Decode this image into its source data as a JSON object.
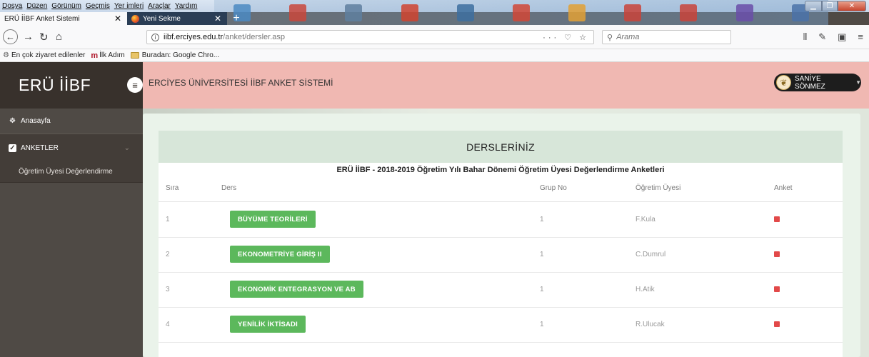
{
  "browser": {
    "menu": [
      "Dosya",
      "Düzen",
      "Görünüm",
      "Geçmiş",
      "Yer imleri",
      "Araçlar",
      "Yardım"
    ],
    "tabs": [
      {
        "label": "ERÜ İİBF Anket Sistemi"
      },
      {
        "label": "Yeni Sekme"
      }
    ],
    "url_host": "iibf.erciyes.edu.tr",
    "url_path": "/anket/dersler.asp",
    "search_placeholder": "Arama",
    "bookmarks": [
      "En çok ziyaret edilenler",
      "İlk Adım",
      "Buradan: Google Chro..."
    ]
  },
  "sidebar": {
    "brand": "ERÜ İİBF",
    "items": [
      {
        "label": "Anasayfa",
        "icon": "dashboard-icon"
      },
      {
        "label": "ANKETLER",
        "icon": "checkbox-icon"
      }
    ],
    "submenu": [
      "Öğretim Üyesi Değerlendirme"
    ]
  },
  "topbar": {
    "title": "ERCİYES ÜNİVERSİTESİ İİBF ANKET SİSTEMİ",
    "user": "SANİYE SÖNMEZ"
  },
  "courses_card": {
    "header": "DERSLERİNİZ",
    "subtitle": "ERÜ İİBF - 2018-2019 Öğretim Yılı Bahar Dönemi Öğretim Üyesi Değerlendirme Anketleri",
    "columns": [
      "Sıra",
      "Ders",
      "Grup No",
      "Öğretim Üyesi",
      "Anket"
    ],
    "rows": [
      {
        "no": "1",
        "course": "BÜYÜME TEORİLERİ",
        "group": "1",
        "teacher": "F.Kula"
      },
      {
        "no": "2",
        "course": "EKONOMETRİYE GİRİŞ II",
        "group": "1",
        "teacher": "C.Dumrul"
      },
      {
        "no": "3",
        "course": "EKONOMİK ENTEGRASYON VE AB",
        "group": "1",
        "teacher": "H.Atik"
      },
      {
        "no": "4",
        "course": "YENİLİK İKTİSADI",
        "group": "1",
        "teacher": "R.Ulucak"
      }
    ]
  },
  "colors": {
    "sidebar": "#4f4a45",
    "brand_bg": "#38312c",
    "topbar": "#f0b8b2",
    "button_green": "#5cb85c",
    "status_red": "#e24949"
  }
}
